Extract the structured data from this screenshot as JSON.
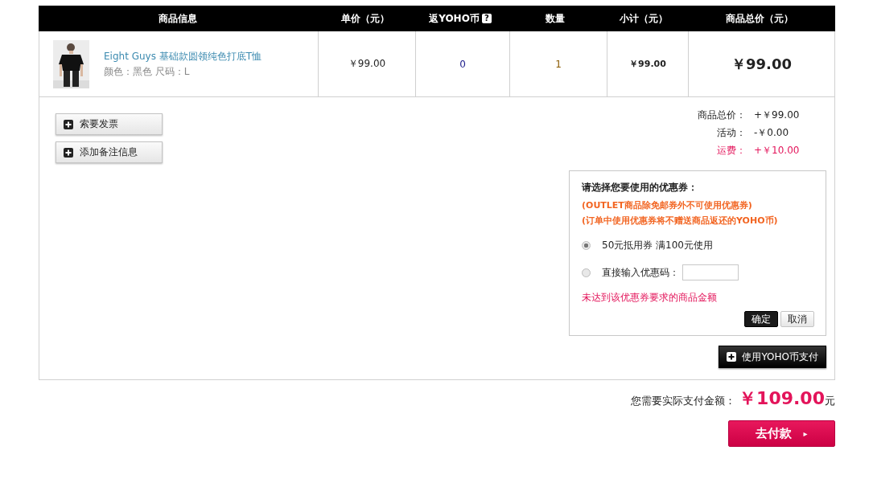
{
  "table": {
    "columns": [
      {
        "label": "商品信息"
      },
      {
        "label": "单价（元）"
      },
      {
        "label": "返YOHO币",
        "help": "?"
      },
      {
        "label": "数量"
      },
      {
        "label": "小计（元）"
      },
      {
        "label": "商品总价（元）"
      }
    ],
    "rows": [
      {
        "name": "Eight Guys 基础款圆领纯色打底T恤",
        "attributes": "颜色：黑色 尺码：L",
        "unit_price": "￥99.00",
        "yoho_coins": "0",
        "quantity": "1",
        "subtotal": "￥99.00",
        "total": "￥99.00"
      }
    ]
  },
  "actions": [
    {
      "label": "索要发票"
    },
    {
      "label": "添加备注信息"
    }
  ],
  "summary": [
    {
      "label": "商品总价：",
      "value": "+￥99.00",
      "highlight": false
    },
    {
      "label": "活动：",
      "value": "-￥0.00",
      "highlight": false
    },
    {
      "label": "运费：",
      "value": "+￥10.00",
      "highlight": true
    }
  ],
  "coupon": {
    "title": "请选择您要使用的优惠券：",
    "notes": [
      "(OUTLET商品除免邮券外不可使用优惠券)",
      "(订单中使用优惠券将不赠送商品返还的YOHO币)"
    ],
    "options": [
      {
        "kind": "coupon",
        "label": "50元抵用券 满100元使用",
        "selected": true
      },
      {
        "kind": "code",
        "label": "直接输入优惠码：",
        "selected": false
      }
    ],
    "error": "未达到该优惠券要求的商品金额",
    "confirm": "确定",
    "cancel": "取消"
  },
  "yoho_pay_button": "使用YOHO币支付",
  "payable": {
    "label": "您需要实际支付金额：",
    "amount": "￥109.00",
    "unit": "元"
  },
  "pay_button": {
    "label": "去付款",
    "arrow": "▸"
  }
}
